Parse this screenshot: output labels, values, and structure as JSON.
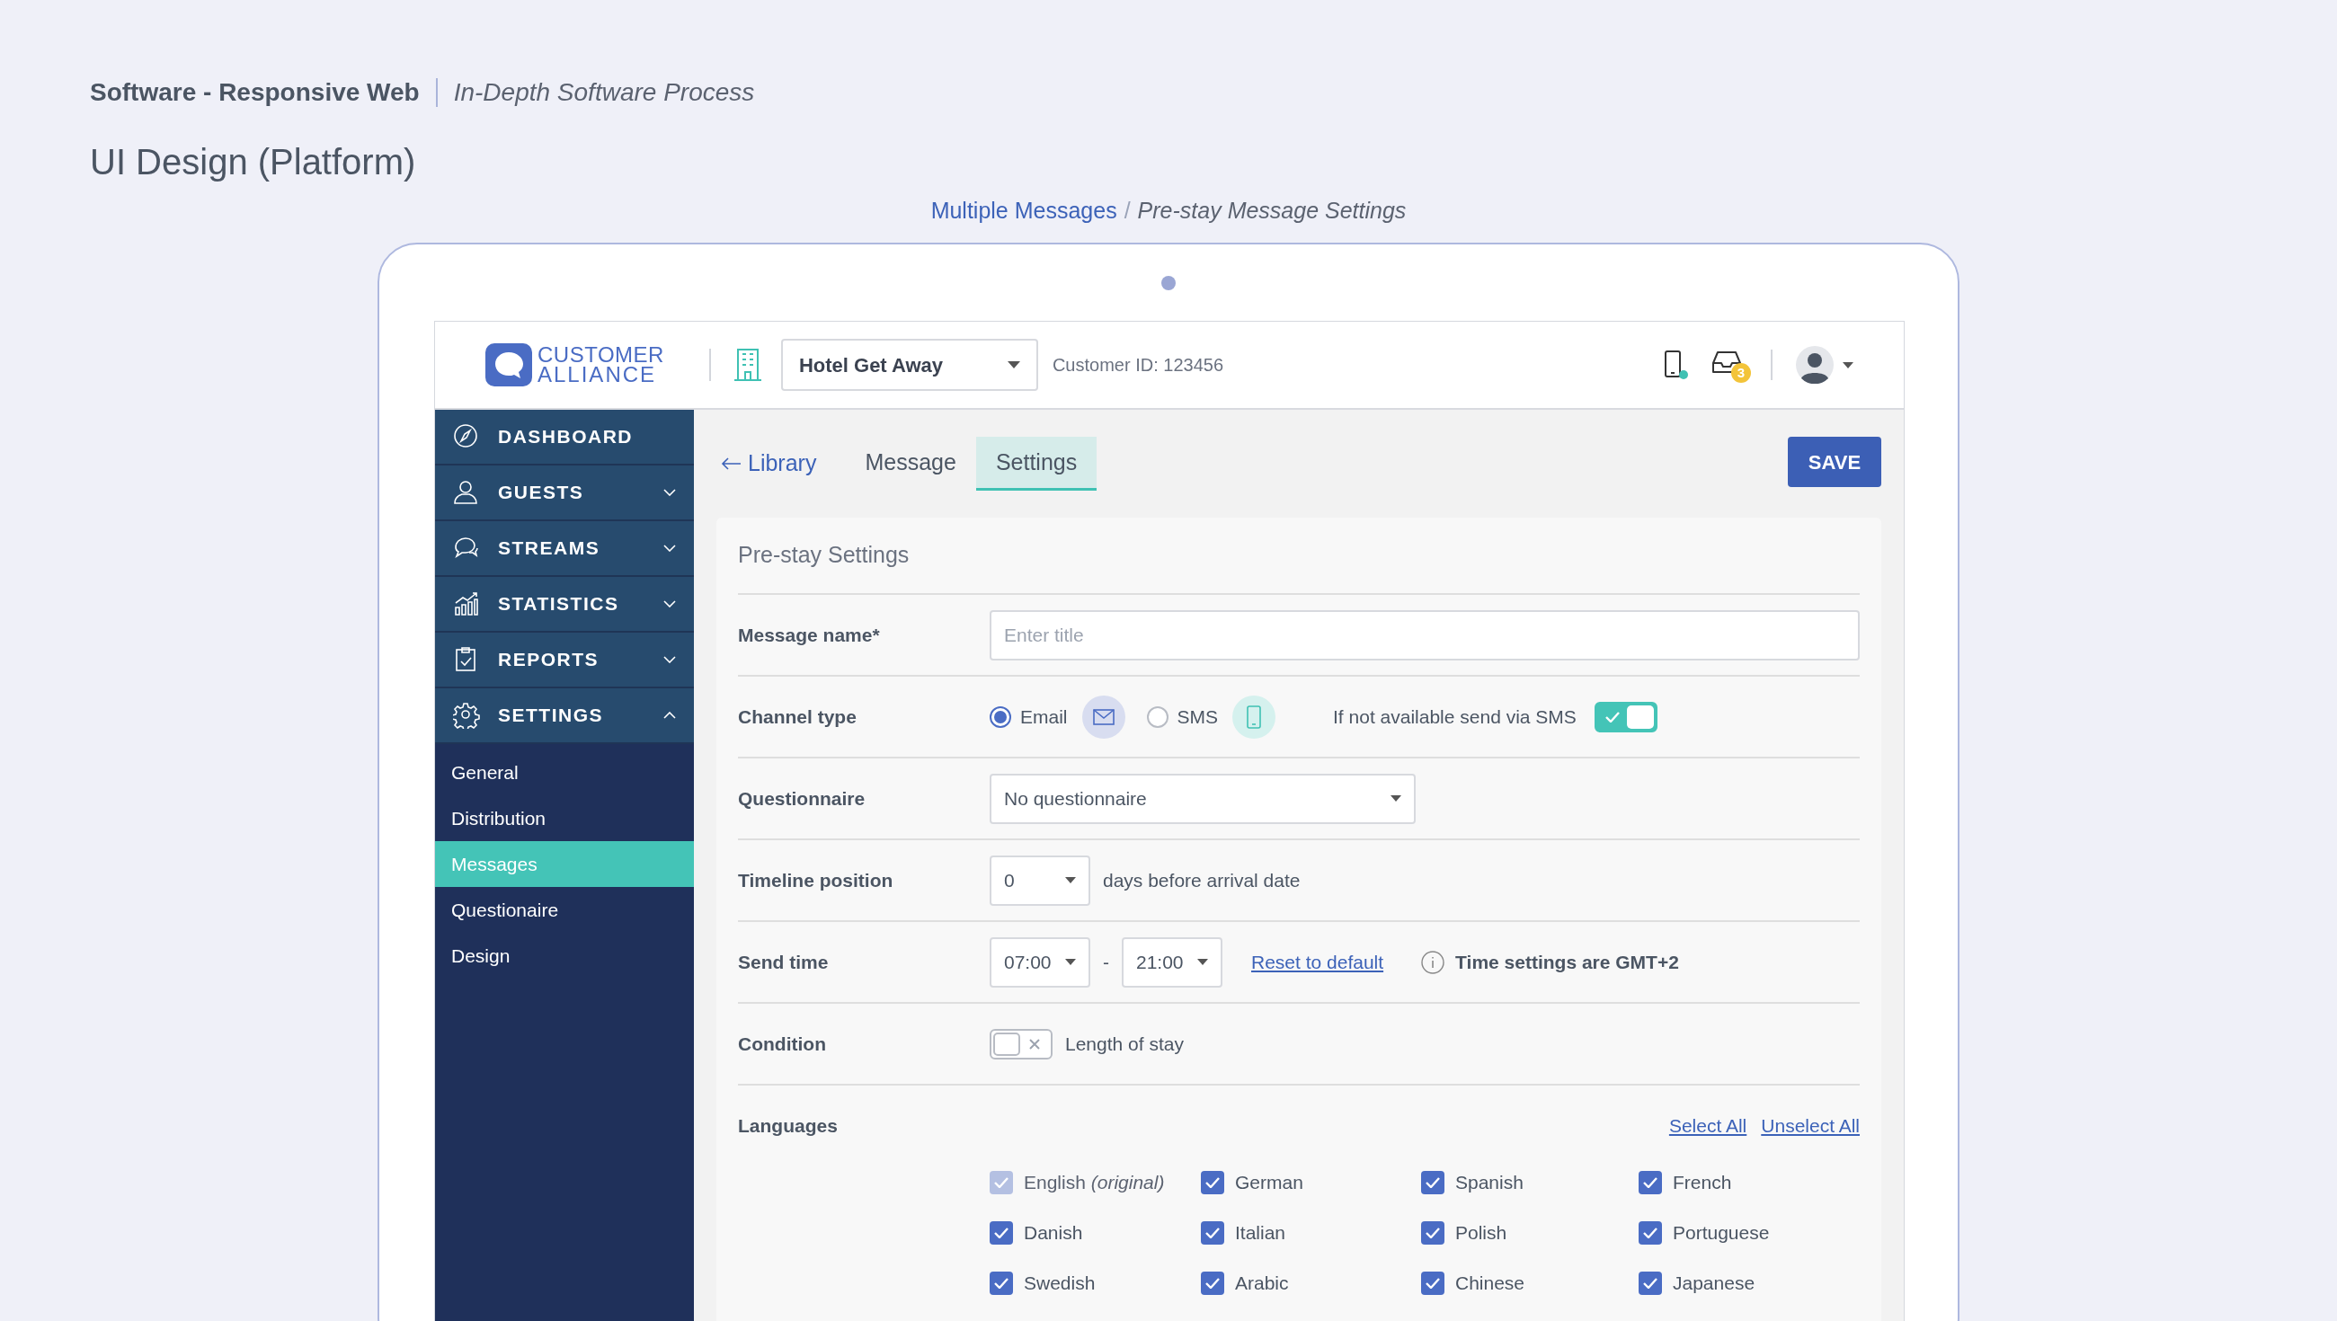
{
  "doc": {
    "project": "Software - Responsive Web",
    "subtitle": "In-Depth Software Process",
    "title": "UI Design (Platform)"
  },
  "breadcrumb": {
    "parent": "Multiple Messages",
    "separator": "/",
    "current": "Pre-stay Message Settings"
  },
  "topbar": {
    "logo": [
      "CUSTOMER",
      "ALLIANCE"
    ],
    "hotel": "Hotel Get Away",
    "customer_id": "Customer ID: 123456",
    "device_online": true,
    "inbox_count": "3"
  },
  "sidebar": {
    "items": [
      {
        "label": "DASHBOARD",
        "kind": "link"
      },
      {
        "label": "GUESTS",
        "kind": "menu",
        "expanded": false
      },
      {
        "label": "STREAMS",
        "kind": "menu",
        "expanded": false
      },
      {
        "label": "STATISTICS",
        "kind": "menu",
        "expanded": false
      },
      {
        "label": "REPORTS",
        "kind": "menu",
        "expanded": false
      },
      {
        "label": "SETTINGS",
        "kind": "menu",
        "expanded": true,
        "children": [
          {
            "label": "General",
            "selected": false
          },
          {
            "label": "Distribution",
            "selected": false
          },
          {
            "label": "Messages",
            "selected": true
          },
          {
            "label": "Questionaire",
            "selected": false
          },
          {
            "label": "Design",
            "selected": false
          }
        ]
      }
    ]
  },
  "nav": {
    "back": "Library",
    "tabs": [
      {
        "label": "Message",
        "selected": false
      },
      {
        "label": "Settings",
        "selected": true
      }
    ],
    "save": "SAVE"
  },
  "form": {
    "title": "Pre-stay Settings",
    "rows": [
      {
        "kind": "text",
        "label": "Message name*",
        "placeholder": "Enter title"
      },
      {
        "kind": "channel",
        "label": "Channel type",
        "options": [
          {
            "label": "Email",
            "selected": true
          },
          {
            "label": "SMS",
            "selected": false
          }
        ],
        "fallback": {
          "label": "If not available send via SMS",
          "on": true
        }
      },
      {
        "kind": "select",
        "label": "Questionnaire",
        "value": "No questionnaire"
      },
      {
        "kind": "timeline",
        "label": "Timeline position",
        "value": "0",
        "suffix": "days before arrival date"
      },
      {
        "kind": "sendtime",
        "label": "Send time",
        "from": "07:00",
        "dash": "-",
        "to": "21:00",
        "reset": "Reset to default",
        "note": "Time settings are GMT+2"
      },
      {
        "kind": "condition",
        "label": "Condition",
        "toggle": {
          "label": "Length of stay",
          "on": false
        }
      }
    ]
  },
  "languages": {
    "label": "Languages",
    "select_all": "Select All",
    "unselect_all": "Unselect All",
    "items": [
      {
        "label": "English *(original)*",
        "checked": true,
        "disabled": true
      },
      {
        "label": "German",
        "checked": true,
        "disabled": false
      },
      {
        "label": "Spanish",
        "checked": true,
        "disabled": false
      },
      {
        "label": "French",
        "checked": true,
        "disabled": false
      },
      {
        "label": "Danish",
        "checked": true,
        "disabled": false
      },
      {
        "label": "Italian",
        "checked": true,
        "disabled": false
      },
      {
        "label": "Polish",
        "checked": true,
        "disabled": false
      },
      {
        "label": "Portuguese",
        "checked": true,
        "disabled": false
      },
      {
        "label": "Swedish",
        "checked": true,
        "disabled": false
      },
      {
        "label": "Arabic",
        "checked": true,
        "disabled": false
      },
      {
        "label": "Chinese",
        "checked": true,
        "disabled": false
      },
      {
        "label": "Japanese",
        "checked": true,
        "disabled": false
      }
    ]
  }
}
